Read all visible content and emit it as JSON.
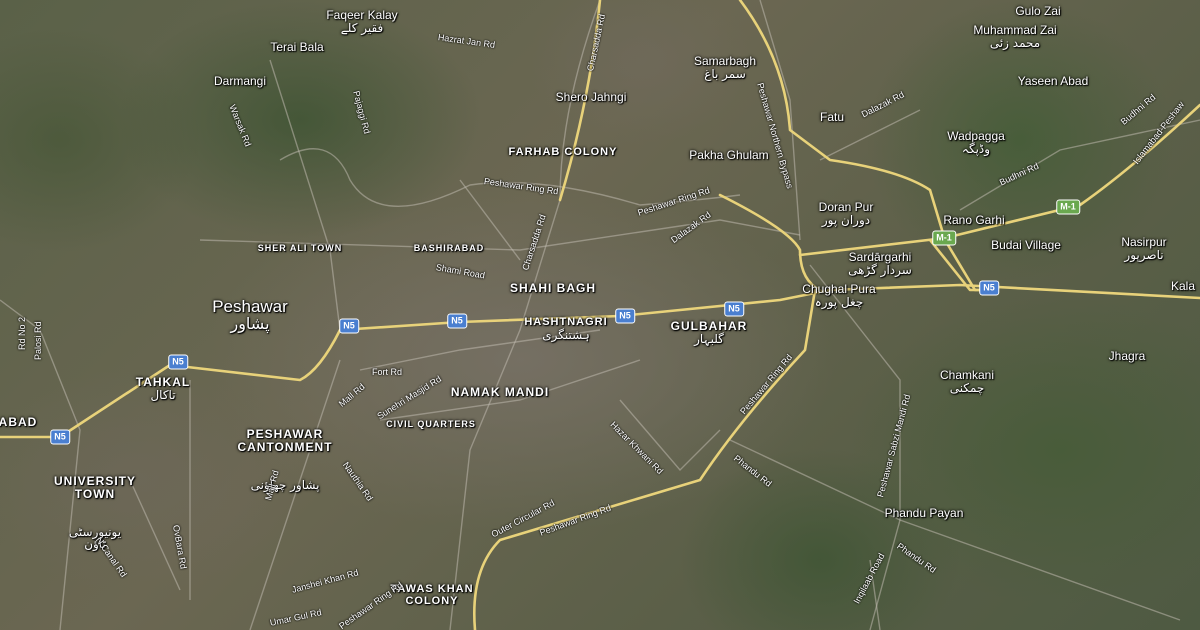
{
  "map": {
    "city": {
      "name": "Peshawar",
      "urdu": "پشاور"
    },
    "places": [
      {
        "id": "faqeer-kalay",
        "name": "Faqeer Kalay",
        "urdu": "فقیر کلے"
      },
      {
        "id": "terai-bala",
        "name": "Terai Bala"
      },
      {
        "id": "darmangi",
        "name": "Darmangi"
      },
      {
        "id": "samarbagh",
        "name": "Samarbagh",
        "urdu": "سمر باغ"
      },
      {
        "id": "shero-jahngi",
        "name": "Shero Jahngi"
      },
      {
        "id": "gulo-zai",
        "name": "Gulo Zai"
      },
      {
        "id": "muhammad-zai",
        "name": "Muhammad Zai",
        "urdu": "محمد زئی"
      },
      {
        "id": "yaseen-abad",
        "name": "Yaseen Abad"
      },
      {
        "id": "fatu",
        "name": "Fatu"
      },
      {
        "id": "wadpagga",
        "name": "Wadpagga",
        "urdu": "وڈپگہ"
      },
      {
        "id": "pakha-ghulam",
        "name": "Pakha Ghulam"
      },
      {
        "id": "doran-pur",
        "name": "Doran Pur",
        "urdu": "دوران پور"
      },
      {
        "id": "rano-garhi",
        "name": "Rano Garhi"
      },
      {
        "id": "budai-village",
        "name": "Budai Village"
      },
      {
        "id": "nasirpur",
        "name": "Nasirpur",
        "urdu": "ناصرپور"
      },
      {
        "id": "sardargarhi",
        "name": "Sardārgarhi",
        "urdu": "سردار گڑھی"
      },
      {
        "id": "chughal-pura",
        "name": "Chughal Pura",
        "urdu": "چغل پورہ"
      },
      {
        "id": "kala",
        "name": "Kala"
      },
      {
        "id": "jhagra",
        "name": "Jhagra"
      },
      {
        "id": "chamkani",
        "name": "Chamkani",
        "urdu": "چمکنی"
      },
      {
        "id": "phandu-payan",
        "name": "Phandu Payan"
      }
    ],
    "districts": [
      {
        "id": "farhab-colony",
        "name": "FARHAB COLONY"
      },
      {
        "id": "sher-ali-town",
        "name": "SHER ALI TOWN"
      },
      {
        "id": "bashirabad",
        "name": "BASHIRABAD"
      },
      {
        "id": "shahi-bagh",
        "name": "SHAHI BAGH"
      },
      {
        "id": "hashtnagri",
        "name": "HASHTNAGRI",
        "urdu": "ہشتنگری"
      },
      {
        "id": "gulbahar",
        "name": "GULBAHAR",
        "urdu": "گلبہار"
      },
      {
        "id": "namak-mandi",
        "name": "NAMAK MANDI"
      },
      {
        "id": "civil-quarters",
        "name": "CIVIL QUARTERS"
      },
      {
        "id": "tahkal",
        "name": "TAHKAL",
        "urdu": "تاکال"
      },
      {
        "id": "peshawar-cantonment",
        "name": "PESHAWAR\nCANTONMENT",
        "urdu": "پشاور چھاؤنی"
      },
      {
        "id": "university-town",
        "name": "UNIVERSITY\nTOWN",
        "urdu": "یونیورسٹی\nٹاؤن"
      },
      {
        "id": "abad",
        "name": "ABAD"
      },
      {
        "id": "tawas-khan-colony",
        "name": "TAWAS KHAN\nCOLONY"
      }
    ],
    "roads": [
      {
        "id": "hazrat-jan-rd",
        "name": "Hazrat Jan Rd"
      },
      {
        "id": "charsadda-rd-north",
        "name": "Charsadda Rd"
      },
      {
        "id": "warsak-rd",
        "name": "Warsak Rd"
      },
      {
        "id": "pajaggi-rd",
        "name": "Pajaggi Rd"
      },
      {
        "id": "peshawar-northern-bypass",
        "name": "Peshawar Northern Bypass"
      },
      {
        "id": "dalazak-rd-north",
        "name": "Dalazak Rd"
      },
      {
        "id": "peshawar-ring-rd-1",
        "name": "Peshawar Ring Rd"
      },
      {
        "id": "peshawar-ring-rd-2",
        "name": "Peshawar Ring Rd"
      },
      {
        "id": "dalazak-rd",
        "name": "Dalazak Rd"
      },
      {
        "id": "charsadda-rd",
        "name": "Charsadda Rd"
      },
      {
        "id": "shami-road",
        "name": "Shami Road"
      },
      {
        "id": "budhni-rd",
        "name": "Budhni Rd"
      },
      {
        "id": "budhni-rd-2",
        "name": "Budhni Rd"
      },
      {
        "id": "islamabad-peshawar",
        "name": "Islamabad-Peshaw"
      },
      {
        "id": "fort-rd",
        "name": "Fort Rd"
      },
      {
        "id": "mall-rd",
        "name": "Mall Rd"
      },
      {
        "id": "sunehri-masjid-rd",
        "name": "Sunehri Masjid Rd"
      },
      {
        "id": "peshawar-ring-rd-3",
        "name": "Peshawar Ring Rd"
      },
      {
        "id": "hazar-khwani-rd",
        "name": "Hazar Khwani Rd"
      },
      {
        "id": "phandu-rd",
        "name": "Phandu Rd"
      },
      {
        "id": "peshawar-sabzi-mandi-rd",
        "name": "Peshawar Sabzi Mandi Rd"
      },
      {
        "id": "nauthia-rd",
        "name": "Nauthia Rd"
      },
      {
        "id": "mall-rd-2",
        "name": "Mall Rd"
      },
      {
        "id": "outer-circular-rd",
        "name": "Outer Circular Rd"
      },
      {
        "id": "peshawar-ring-rd-4",
        "name": "Peshawar Ring Rd"
      },
      {
        "id": "ring-rd-5",
        "name": "Peshawar Ring Rd"
      },
      {
        "id": "janshei-khan-rd",
        "name": "Janshei Khan Rd"
      },
      {
        "id": "ovbara-rd",
        "name": "OvBara Rd"
      },
      {
        "id": "n-canal-rd",
        "name": "N Canal Rd"
      },
      {
        "id": "palosi-rd",
        "name": "Palosi Rd"
      },
      {
        "id": "rd-no-2",
        "name": "Rd No 2"
      },
      {
        "id": "umar-gul-rd",
        "name": "Umar Gul Rd"
      },
      {
        "id": "inqilaab-road",
        "name": "Inqilaab Road"
      },
      {
        "id": "phandu-rd-2",
        "name": "Phandu Rd"
      }
    ],
    "shields": [
      {
        "id": "n5-1",
        "label": "N5",
        "color": "#4a7fd0"
      },
      {
        "id": "n5-2",
        "label": "N5",
        "color": "#4a7fd0"
      },
      {
        "id": "n5-3",
        "label": "N5",
        "color": "#4a7fd0"
      },
      {
        "id": "n5-4",
        "label": "N5",
        "color": "#4a7fd0"
      },
      {
        "id": "n5-5",
        "label": "N5",
        "color": "#4a7fd0"
      },
      {
        "id": "n5-6",
        "label": "N5",
        "color": "#4a7fd0"
      },
      {
        "id": "n5-7",
        "label": "N5",
        "color": "#4a7fd0"
      },
      {
        "id": "m1-1",
        "label": "M-1",
        "color": "#6aa84f"
      },
      {
        "id": "m1-2",
        "label": "M-1",
        "color": "#6aa84f"
      }
    ],
    "colors": {
      "major_road": "#e8d27a",
      "minor_road": "#bdb8ad",
      "shield_national": "#4a7fd0",
      "shield_motorway": "#6aa84f"
    }
  }
}
